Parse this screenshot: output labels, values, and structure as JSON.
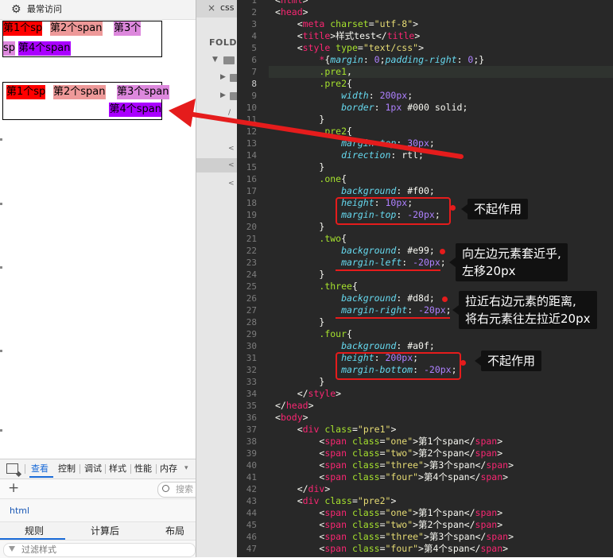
{
  "browser": {
    "bookmark_label": "最常访问",
    "demo1_spans": [
      "第1个sp",
      "第2个span",
      "第3个",
      "sp",
      "第4个span"
    ],
    "demo2_spans": [
      "第1个sp",
      "第2个span",
      "第3个span",
      "第4个span"
    ]
  },
  "devtools": {
    "tabs": [
      "查看",
      "控制",
      "调试",
      "样式",
      "性能",
      "内存"
    ],
    "search_placeholder": "搜索",
    "selected_node": "html",
    "sub_tabs": [
      "规则",
      "计算后",
      "布局"
    ],
    "filter_placeholder": "过滤样式"
  },
  "sidebar": {
    "tab_close": "×",
    "tab_name": "css",
    "folders_label": "FOLD"
  },
  "editor": {
    "first_line_number": 1,
    "active_line_number": 8,
    "lines": [
      [
        [
          "&lt;",
          "c-pun"
        ],
        [
          "html",
          "c-tag"
        ],
        [
          "&gt;",
          "c-pun"
        ]
      ],
      [
        [
          "&lt;",
          "c-pun"
        ],
        [
          "head",
          "c-tag"
        ],
        [
          "&gt;",
          "c-pun"
        ]
      ],
      [
        [
          "    &lt;",
          "c-pun"
        ],
        [
          "meta",
          "c-tag"
        ],
        [
          " charset",
          "c-attr"
        ],
        [
          "=",
          "c-pun"
        ],
        [
          "\"utf-8\"",
          "c-str"
        ],
        [
          "&gt;",
          "c-pun"
        ]
      ],
      [
        [
          "    &lt;",
          "c-pun"
        ],
        [
          "title",
          "c-tag"
        ],
        [
          "&gt;样式test&lt;/",
          "c-pun"
        ],
        [
          "title",
          "c-tag"
        ],
        [
          "&gt;",
          "c-pun"
        ]
      ],
      [
        [
          "    &lt;",
          "c-pun"
        ],
        [
          "style",
          "c-tag"
        ],
        [
          " type",
          "c-attr"
        ],
        [
          "=",
          "c-pun"
        ],
        [
          "\"text/css\"",
          "c-str"
        ],
        [
          "&gt;",
          "c-pun"
        ]
      ],
      [
        [
          "        ",
          "c-pun"
        ],
        [
          "*",
          "c-star"
        ],
        [
          "{",
          "c-pun"
        ],
        [
          "margin",
          "c-prop"
        ],
        [
          ": ",
          "c-pun"
        ],
        [
          "0",
          "c-num"
        ],
        [
          ";",
          "c-pun"
        ],
        [
          "padding-right",
          "c-prop"
        ],
        [
          ": ",
          "c-pun"
        ],
        [
          "0",
          "c-num"
        ],
        [
          ";}",
          "c-pun"
        ]
      ],
      [
        [
          "        ",
          "c-pun"
        ],
        [
          ".pre1",
          "c-sel"
        ],
        [
          ",",
          "c-pun"
        ]
      ],
      [
        [
          "        ",
          "c-pun"
        ],
        [
          ".pre2",
          "c-sel"
        ],
        [
          "{",
          "c-pun"
        ]
      ],
      [
        [
          "            ",
          "c-pun"
        ],
        [
          "width",
          "c-prop"
        ],
        [
          ": ",
          "c-pun"
        ],
        [
          "200px",
          "c-num"
        ],
        [
          ";",
          "c-pun"
        ]
      ],
      [
        [
          "            ",
          "c-pun"
        ],
        [
          "border",
          "c-prop"
        ],
        [
          ": ",
          "c-pun"
        ],
        [
          "1px",
          "c-num"
        ],
        [
          " #000 solid;",
          "c-pun"
        ]
      ],
      [
        [
          "        }",
          "c-pun"
        ]
      ],
      [
        [
          "        ",
          "c-pun"
        ],
        [
          ".pre2",
          "c-sel"
        ],
        [
          "{",
          "c-pun"
        ]
      ],
      [
        [
          "            ",
          "c-pun"
        ],
        [
          "margin-top",
          "c-prop"
        ],
        [
          ": ",
          "c-pun"
        ],
        [
          "30px",
          "c-num"
        ],
        [
          ";",
          "c-pun"
        ]
      ],
      [
        [
          "            ",
          "c-pun"
        ],
        [
          "direction",
          "c-prop"
        ],
        [
          ": rtl;",
          "c-pun"
        ]
      ],
      [
        [
          "        }",
          "c-pun"
        ]
      ],
      [
        [
          "        ",
          "c-pun"
        ],
        [
          ".one",
          "c-sel"
        ],
        [
          "{",
          "c-pun"
        ]
      ],
      [
        [
          "            ",
          "c-pun"
        ],
        [
          "background",
          "c-prop"
        ],
        [
          ": #f00;",
          "c-pun"
        ]
      ],
      [
        [
          "            ",
          "c-pun"
        ],
        [
          "height",
          "c-prop"
        ],
        [
          ": ",
          "c-pun"
        ],
        [
          "10px",
          "c-num"
        ],
        [
          ";",
          "c-pun"
        ]
      ],
      [
        [
          "            ",
          "c-pun"
        ],
        [
          "margin-top",
          "c-prop"
        ],
        [
          ": ",
          "c-pun"
        ],
        [
          "-20px",
          "c-num"
        ],
        [
          ";",
          "c-pun"
        ]
      ],
      [
        [
          "        }",
          "c-pun"
        ]
      ],
      [
        [
          "        ",
          "c-pun"
        ],
        [
          ".two",
          "c-sel"
        ],
        [
          "{",
          "c-pun"
        ]
      ],
      [
        [
          "            ",
          "c-pun"
        ],
        [
          "background",
          "c-prop"
        ],
        [
          ": #e99;",
          "c-pun"
        ]
      ],
      [
        [
          "            ",
          "c-pun"
        ],
        [
          "margin-left",
          "c-prop"
        ],
        [
          ": ",
          "c-pun"
        ],
        [
          "-20px",
          "c-num"
        ],
        [
          ";",
          "c-pun"
        ]
      ],
      [
        [
          "        }",
          "c-pun"
        ]
      ],
      [
        [
          "        ",
          "c-pun"
        ],
        [
          ".three",
          "c-sel"
        ],
        [
          "{",
          "c-pun"
        ]
      ],
      [
        [
          "            ",
          "c-pun"
        ],
        [
          "background",
          "c-prop"
        ],
        [
          ": #d8d;",
          "c-pun"
        ]
      ],
      [
        [
          "            ",
          "c-pun"
        ],
        [
          "margin-right",
          "c-prop"
        ],
        [
          ": ",
          "c-pun"
        ],
        [
          "-20px",
          "c-num"
        ],
        [
          ";",
          "c-pun"
        ]
      ],
      [
        [
          "        }",
          "c-pun"
        ]
      ],
      [
        [
          "        ",
          "c-pun"
        ],
        [
          ".four",
          "c-sel"
        ],
        [
          "{",
          "c-pun"
        ]
      ],
      [
        [
          "            ",
          "c-pun"
        ],
        [
          "background",
          "c-prop"
        ],
        [
          ": #a0f;",
          "c-pun"
        ]
      ],
      [
        [
          "            ",
          "c-pun"
        ],
        [
          "height",
          "c-prop"
        ],
        [
          ": ",
          "c-pun"
        ],
        [
          "200px",
          "c-num"
        ],
        [
          ";",
          "c-pun"
        ]
      ],
      [
        [
          "            ",
          "c-pun"
        ],
        [
          "margin-bottom",
          "c-prop"
        ],
        [
          ": ",
          "c-pun"
        ],
        [
          "-20px",
          "c-num"
        ],
        [
          ";",
          "c-pun"
        ]
      ],
      [
        [
          "        }",
          "c-pun"
        ]
      ],
      [
        [
          "    &lt;/",
          "c-pun"
        ],
        [
          "style",
          "c-tag"
        ],
        [
          "&gt;",
          "c-pun"
        ]
      ],
      [
        [
          "&lt;/",
          "c-pun"
        ],
        [
          "head",
          "c-tag"
        ],
        [
          "&gt;",
          "c-pun"
        ]
      ],
      [
        [
          "&lt;",
          "c-pun"
        ],
        [
          "body",
          "c-tag"
        ],
        [
          "&gt;",
          "c-pun"
        ]
      ],
      [
        [
          "    &lt;",
          "c-pun"
        ],
        [
          "div",
          "c-tag"
        ],
        [
          " class",
          "c-attr"
        ],
        [
          "=",
          "c-pun"
        ],
        [
          "\"pre1\"",
          "c-str"
        ],
        [
          "&gt;",
          "c-pun"
        ]
      ],
      [
        [
          "        &lt;",
          "c-pun"
        ],
        [
          "span",
          "c-tag"
        ],
        [
          " class",
          "c-attr"
        ],
        [
          "=",
          "c-pun"
        ],
        [
          "\"one\"",
          "c-str"
        ],
        [
          "&gt;第1个span&lt;/",
          "c-pun"
        ],
        [
          "span",
          "c-tag"
        ],
        [
          "&gt;",
          "c-pun"
        ]
      ],
      [
        [
          "        &lt;",
          "c-pun"
        ],
        [
          "span",
          "c-tag"
        ],
        [
          " class",
          "c-attr"
        ],
        [
          "=",
          "c-pun"
        ],
        [
          "\"two\"",
          "c-str"
        ],
        [
          "&gt;第2个span&lt;/",
          "c-pun"
        ],
        [
          "span",
          "c-tag"
        ],
        [
          "&gt;",
          "c-pun"
        ]
      ],
      [
        [
          "        &lt;",
          "c-pun"
        ],
        [
          "span",
          "c-tag"
        ],
        [
          " class",
          "c-attr"
        ],
        [
          "=",
          "c-pun"
        ],
        [
          "\"three\"",
          "c-str"
        ],
        [
          "&gt;第3个span&lt;/",
          "c-pun"
        ],
        [
          "span",
          "c-tag"
        ],
        [
          "&gt;",
          "c-pun"
        ]
      ],
      [
        [
          "        &lt;",
          "c-pun"
        ],
        [
          "span",
          "c-tag"
        ],
        [
          " class",
          "c-attr"
        ],
        [
          "=",
          "c-pun"
        ],
        [
          "\"four\"",
          "c-str"
        ],
        [
          "&gt;第4个span&lt;/",
          "c-pun"
        ],
        [
          "span",
          "c-tag"
        ],
        [
          "&gt;",
          "c-pun"
        ]
      ],
      [
        [
          "    &lt;/",
          "c-pun"
        ],
        [
          "div",
          "c-tag"
        ],
        [
          "&gt;",
          "c-pun"
        ]
      ],
      [
        [
          "    &lt;",
          "c-pun"
        ],
        [
          "div",
          "c-tag"
        ],
        [
          " class",
          "c-attr"
        ],
        [
          "=",
          "c-pun"
        ],
        [
          "\"pre2\"",
          "c-str"
        ],
        [
          "&gt;",
          "c-pun"
        ]
      ],
      [
        [
          "        &lt;",
          "c-pun"
        ],
        [
          "span",
          "c-tag"
        ],
        [
          " class",
          "c-attr"
        ],
        [
          "=",
          "c-pun"
        ],
        [
          "\"one\"",
          "c-str"
        ],
        [
          "&gt;第1个span&lt;/",
          "c-pun"
        ],
        [
          "span",
          "c-tag"
        ],
        [
          "&gt;",
          "c-pun"
        ]
      ],
      [
        [
          "        &lt;",
          "c-pun"
        ],
        [
          "span",
          "c-tag"
        ],
        [
          " class",
          "c-attr"
        ],
        [
          "=",
          "c-pun"
        ],
        [
          "\"two\"",
          "c-str"
        ],
        [
          "&gt;第2个span&lt;/",
          "c-pun"
        ],
        [
          "span",
          "c-tag"
        ],
        [
          "&gt;",
          "c-pun"
        ]
      ],
      [
        [
          "        &lt;",
          "c-pun"
        ],
        [
          "span",
          "c-tag"
        ],
        [
          " class",
          "c-attr"
        ],
        [
          "=",
          "c-pun"
        ],
        [
          "\"three\"",
          "c-str"
        ],
        [
          "&gt;第3个span&lt;/",
          "c-pun"
        ],
        [
          "span",
          "c-tag"
        ],
        [
          "&gt;",
          "c-pun"
        ]
      ],
      [
        [
          "        &lt;",
          "c-pun"
        ],
        [
          "span",
          "c-tag"
        ],
        [
          " class",
          "c-attr"
        ],
        [
          "=",
          "c-pun"
        ],
        [
          "\"four\"",
          "c-str"
        ],
        [
          "&gt;第4个span&lt;/",
          "c-pun"
        ],
        [
          "span",
          "c-tag"
        ],
        [
          "&gt;",
          "c-pun"
        ]
      ]
    ]
  },
  "annotations": {
    "callout_one": "不起作用",
    "callout_two": [
      "向左边元素套近乎,",
      "左移20px"
    ],
    "callout_three": [
      "拉近右边元素的距离,",
      "将右元素往左拉近20px"
    ],
    "callout_four": "不起作用",
    "accent_color": "#e51c1c"
  }
}
